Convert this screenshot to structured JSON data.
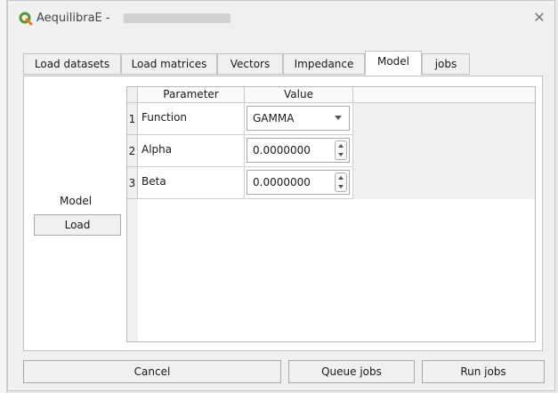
{
  "window": {
    "title": "AequilibraE -",
    "close_glyph": "✕"
  },
  "tabs": [
    {
      "label": "Load datasets"
    },
    {
      "label": "Load matrices"
    },
    {
      "label": "Vectors"
    },
    {
      "label": "Impedance"
    },
    {
      "label": "Model",
      "active": true
    },
    {
      "label": "jobs"
    }
  ],
  "model_panel": {
    "model_label": "Model",
    "load_label": "Load"
  },
  "parameters_table": {
    "columns": [
      "Parameter",
      "Value"
    ],
    "rows": [
      {
        "index": "1",
        "parameter": "Function",
        "value": "GAMMA",
        "widget": "dropdown"
      },
      {
        "index": "2",
        "parameter": "Alpha",
        "value": "0.0000000",
        "widget": "spinbox"
      },
      {
        "index": "3",
        "parameter": "Beta",
        "value": "0.0000000",
        "widget": "spinbox"
      }
    ]
  },
  "footer": {
    "cancel_label": "Cancel",
    "queue_label": "Queue jobs",
    "run_label": "Run jobs"
  },
  "colors": {
    "qgis_green": "#589632",
    "qgis_yellow": "#ee7913"
  }
}
